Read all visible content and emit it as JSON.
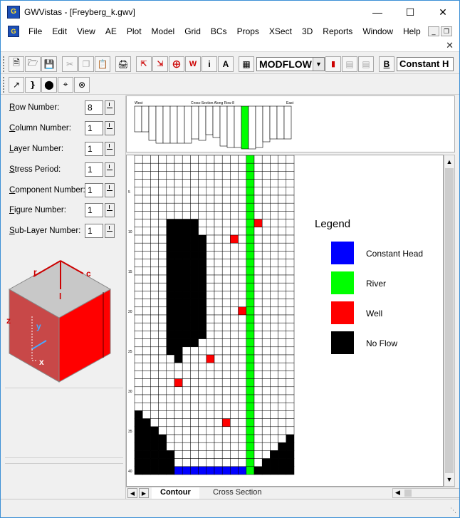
{
  "window": {
    "app_name": "GWVistas",
    "file_name": "[Freyberg_k.gwv]",
    "title_separator": " - "
  },
  "menu": {
    "items": [
      "File",
      "Edit",
      "View",
      "AE",
      "Plot",
      "Model",
      "Grid",
      "BCs",
      "Props",
      "XSect",
      "3D",
      "Reports",
      "Window",
      "Help"
    ]
  },
  "toolbar": {
    "model_select": "MODFLOW",
    "bc_type": "Constant H",
    "bc_button_label": "B"
  },
  "fields": [
    {
      "label": "Row Number:",
      "underline": "R",
      "rest": "ow Number:",
      "value": "8"
    },
    {
      "label": "Column Number:",
      "underline": "C",
      "rest": "olumn Number:",
      "value": "1"
    },
    {
      "label": "Layer Number:",
      "underline": "L",
      "rest": "ayer Number:",
      "value": "1"
    },
    {
      "label": "Stress Period:",
      "underline": "S",
      "rest": "tress Period:",
      "value": "1"
    },
    {
      "label": "Component Number:",
      "underline": "C",
      "rest": "omponent Number:",
      "value": "1"
    },
    {
      "label": "Figure Number:",
      "underline": "F",
      "rest": "igure Number:",
      "value": "1"
    },
    {
      "label": "Sub-Layer Number:",
      "underline": "S",
      "rest": "ub-Layer Number:",
      "value": "1"
    }
  ],
  "cube": {
    "labels": {
      "r": "r",
      "c": "c",
      "l": "l",
      "z": "z",
      "y": "y",
      "x": "x"
    }
  },
  "cross_section": {
    "title": "Cross-Section Along Row 8",
    "left_label": "West",
    "right_label": "East"
  },
  "grid_map": {
    "row_labels": [
      "5",
      "10",
      "15",
      "20",
      "25",
      "30",
      "35",
      "40"
    ]
  },
  "legend": {
    "title": "Legend",
    "entries": [
      {
        "label": "Constant Head",
        "color": "#0000ff"
      },
      {
        "label": "River",
        "color": "#00ff00"
      },
      {
        "label": "Well",
        "color": "#ff0000"
      },
      {
        "label": "No Flow",
        "color": "#000000"
      }
    ]
  },
  "tabs": {
    "contour": "Contour",
    "cross_section": "Cross Section"
  },
  "colors": {
    "constant_head": "#0000ff",
    "river": "#00ff00",
    "well": "#ff0000",
    "no_flow": "#000000",
    "cube_top": "#c8c8c8",
    "cube_front": "#ff0000",
    "cube_side": "#d04848"
  }
}
